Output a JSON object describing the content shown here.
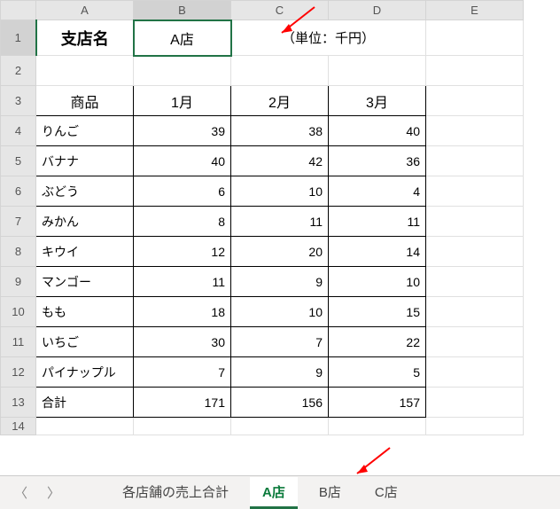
{
  "columns": [
    "A",
    "B",
    "C",
    "D",
    "E"
  ],
  "row_numbers": [
    1,
    2,
    3,
    4,
    5,
    6,
    7,
    8,
    9,
    10,
    11,
    12,
    13,
    14
  ],
  "header": {
    "branch_label": "支店名",
    "branch_value": "A店",
    "units": "（単位：千円）"
  },
  "table": {
    "headers": [
      "商品",
      "1月",
      "2月",
      "3月"
    ],
    "rows": [
      {
        "name": "りんご",
        "m1": 39,
        "m2": 38,
        "m3": 40
      },
      {
        "name": "バナナ",
        "m1": 40,
        "m2": 42,
        "m3": 36
      },
      {
        "name": "ぶどう",
        "m1": 6,
        "m2": 10,
        "m3": 4
      },
      {
        "name": "みかん",
        "m1": 8,
        "m2": 11,
        "m3": 11
      },
      {
        "name": "キウイ",
        "m1": 12,
        "m2": 20,
        "m3": 14
      },
      {
        "name": "マンゴー",
        "m1": 11,
        "m2": 9,
        "m3": 10
      },
      {
        "name": "もも",
        "m1": 18,
        "m2": 10,
        "m3": 15
      },
      {
        "name": "いちご",
        "m1": 30,
        "m2": 7,
        "m3": 22
      },
      {
        "name": "パイナップル",
        "m1": 7,
        "m2": 9,
        "m3": 5
      }
    ],
    "total": {
      "name": "合計",
      "m1": 171,
      "m2": 156,
      "m3": 157
    }
  },
  "tabs": {
    "items": [
      "各店舗の売上合計",
      "A店",
      "B店",
      "C店"
    ],
    "active_index": 1
  },
  "selected_cell": "B1"
}
